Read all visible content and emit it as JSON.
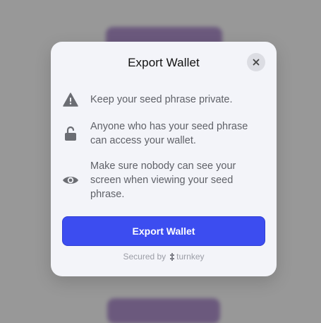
{
  "modal": {
    "title": "Export Wallet",
    "warnings": [
      {
        "icon": "warning-triangle-icon",
        "text": "Keep your seed phrase private."
      },
      {
        "icon": "unlocked-padlock-icon",
        "text": "Anyone who has your seed phrase can access your wallet."
      },
      {
        "icon": "eye-icon",
        "text": "Make sure nobody can see your screen when viewing your seed phrase."
      }
    ],
    "export_button_label": "Export Wallet",
    "footer": {
      "secured_by": "Secured by",
      "brand": "turnkey"
    }
  },
  "colors": {
    "primary_button": "#3c4df0",
    "modal_background": "#f3f4f9",
    "backdrop": "#9a9a9a"
  }
}
